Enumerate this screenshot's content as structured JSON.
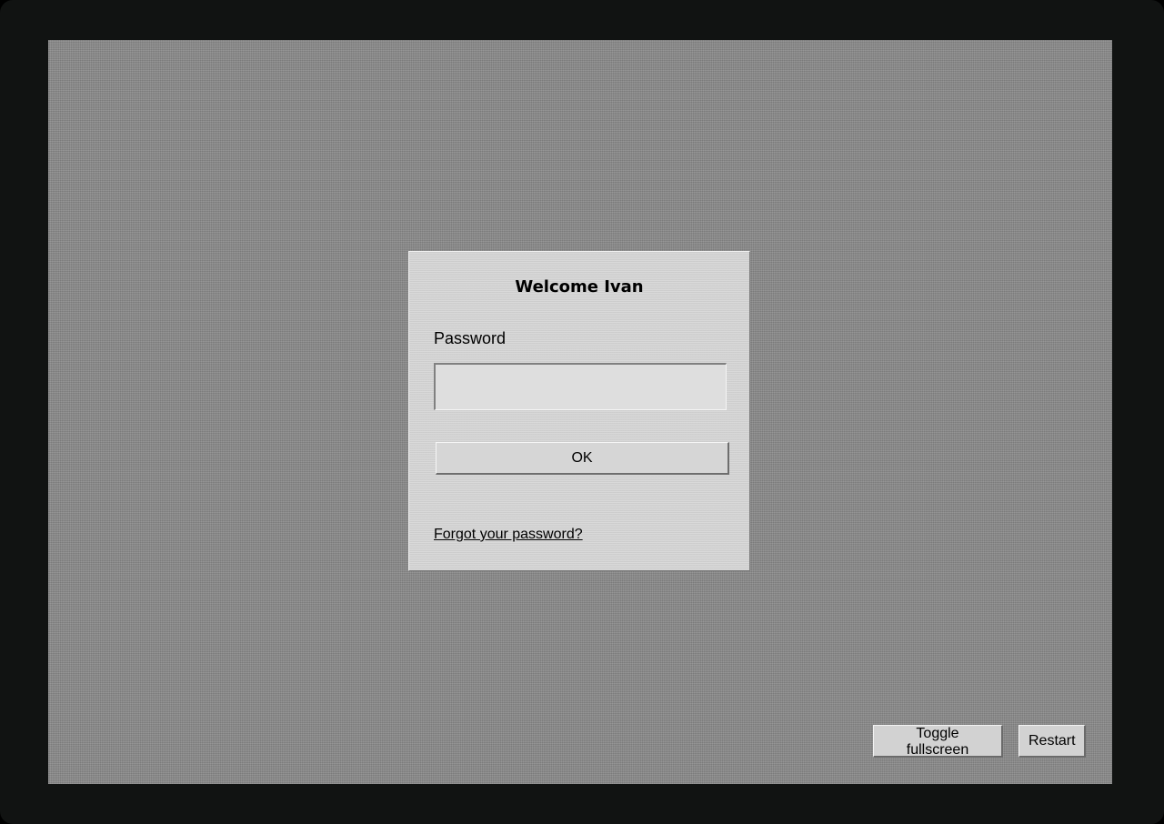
{
  "login_dialog": {
    "title": "Welcome Ivan",
    "password_label": "Password",
    "password_value": "",
    "ok_label": "OK",
    "forgot_link": "Forgot your password?"
  },
  "controls": {
    "toggle_fullscreen": "Toggle fullscreen",
    "restart": "Restart"
  },
  "colors": {
    "desktop": "#8a8a8a",
    "dialog": "#d4d4d4",
    "bezel": "#111312"
  }
}
